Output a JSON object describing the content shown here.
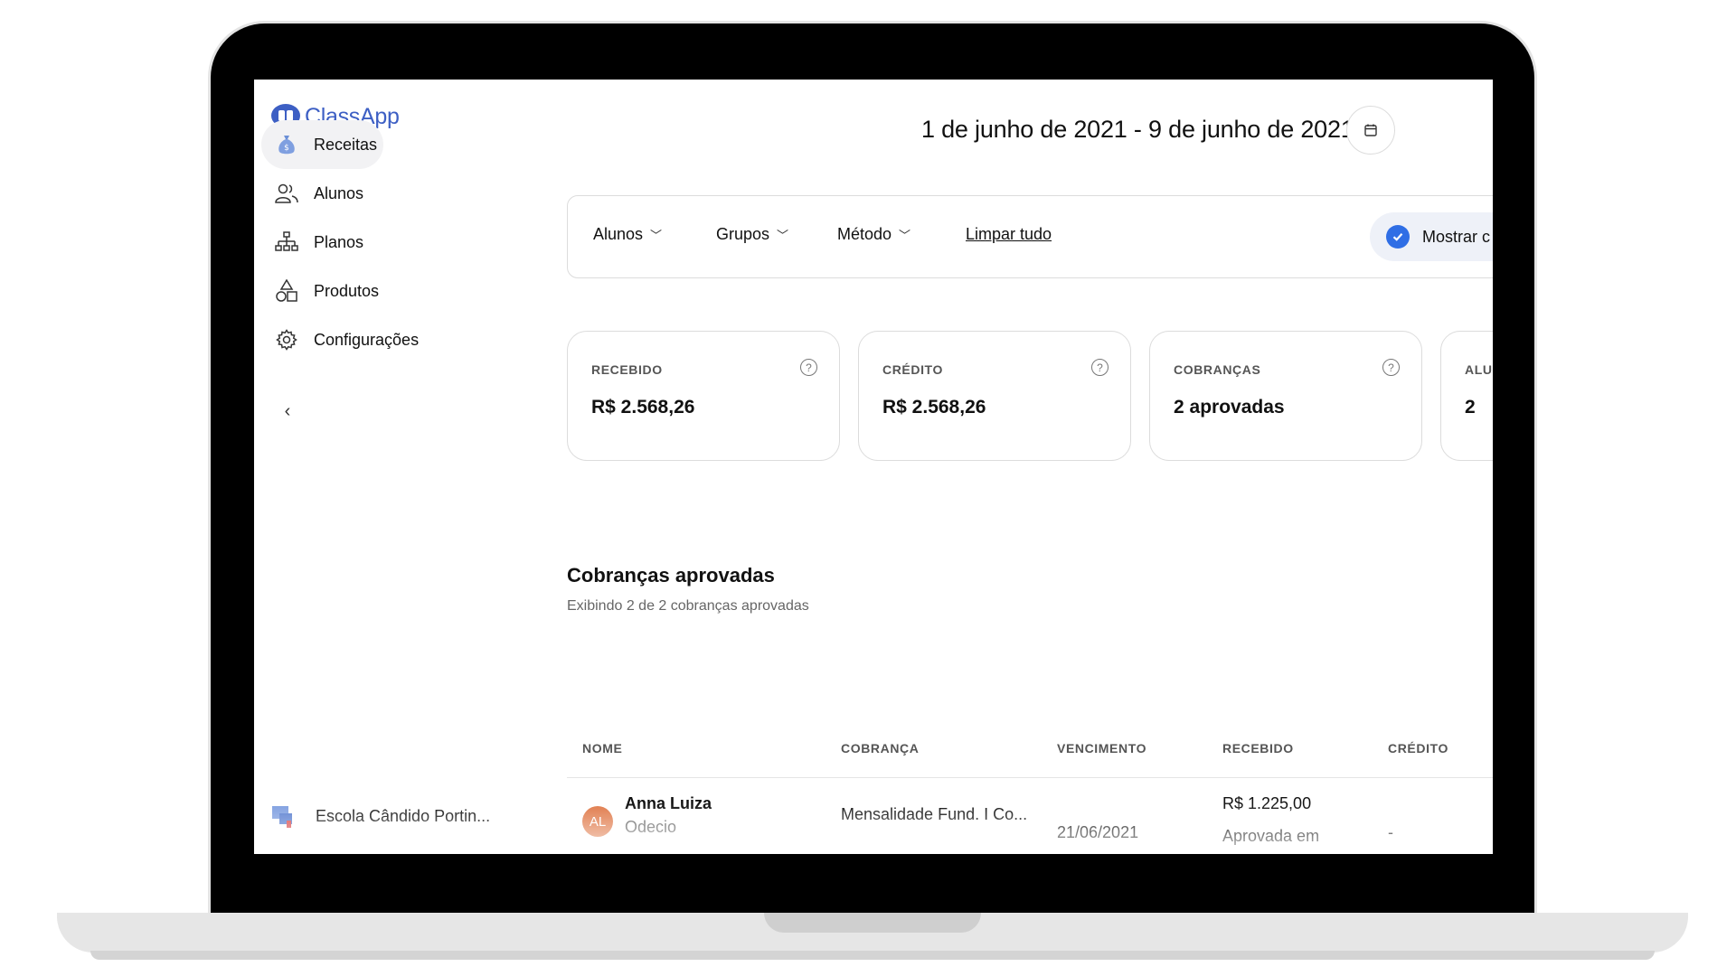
{
  "app": {
    "name": "ClassApp"
  },
  "sidebar": {
    "items": [
      {
        "label": "Receitas",
        "icon": "money-bag-icon",
        "active": true
      },
      {
        "label": "Alunos",
        "icon": "users-icon",
        "active": false
      },
      {
        "label": "Planos",
        "icon": "hierarchy-icon",
        "active": false
      },
      {
        "label": "Produtos",
        "icon": "shapes-icon",
        "active": false
      },
      {
        "label": "Configurações",
        "icon": "gear-icon",
        "active": false
      }
    ],
    "collapse_icon": "‹",
    "school_name": "Escola Cândido Portin..."
  },
  "header": {
    "date_range": "1 de junho de 2021 - 9 de junho de 2021"
  },
  "filters": {
    "items": [
      "Alunos",
      "Grupos",
      "Método"
    ],
    "clear_all": "Limpar tudo",
    "show_toggle": "Mostrar c"
  },
  "cards": [
    {
      "label": "RECEBIDO",
      "value": "R$ 2.568,26"
    },
    {
      "label": "CRÉDITO",
      "value": "R$ 2.568,26"
    },
    {
      "label": "COBRANÇAS",
      "value": "2 aprovadas"
    },
    {
      "label": "ALUI",
      "value": "2"
    }
  ],
  "section": {
    "title": "Cobranças aprovadas",
    "subtitle": "Exibindo 2 de 2 cobranças aprovadas"
  },
  "table": {
    "columns": [
      "NOME",
      "COBRANÇA",
      "VENCIMENTO",
      "RECEBIDO",
      "CRÉDITO"
    ],
    "rows": [
      {
        "initials": "AL",
        "name": "Anna Luiza",
        "guardian": "Odecio",
        "charge": "Mensalidade Fund. I Co...",
        "due": "21/06/2021",
        "received": "R$ 1.225,00",
        "received_status": "Aprovada em",
        "credit": "-"
      }
    ]
  },
  "colors": {
    "brand": "#3d5fc4",
    "accent": "#2f6ee5",
    "avatar": "#e07a4a"
  }
}
